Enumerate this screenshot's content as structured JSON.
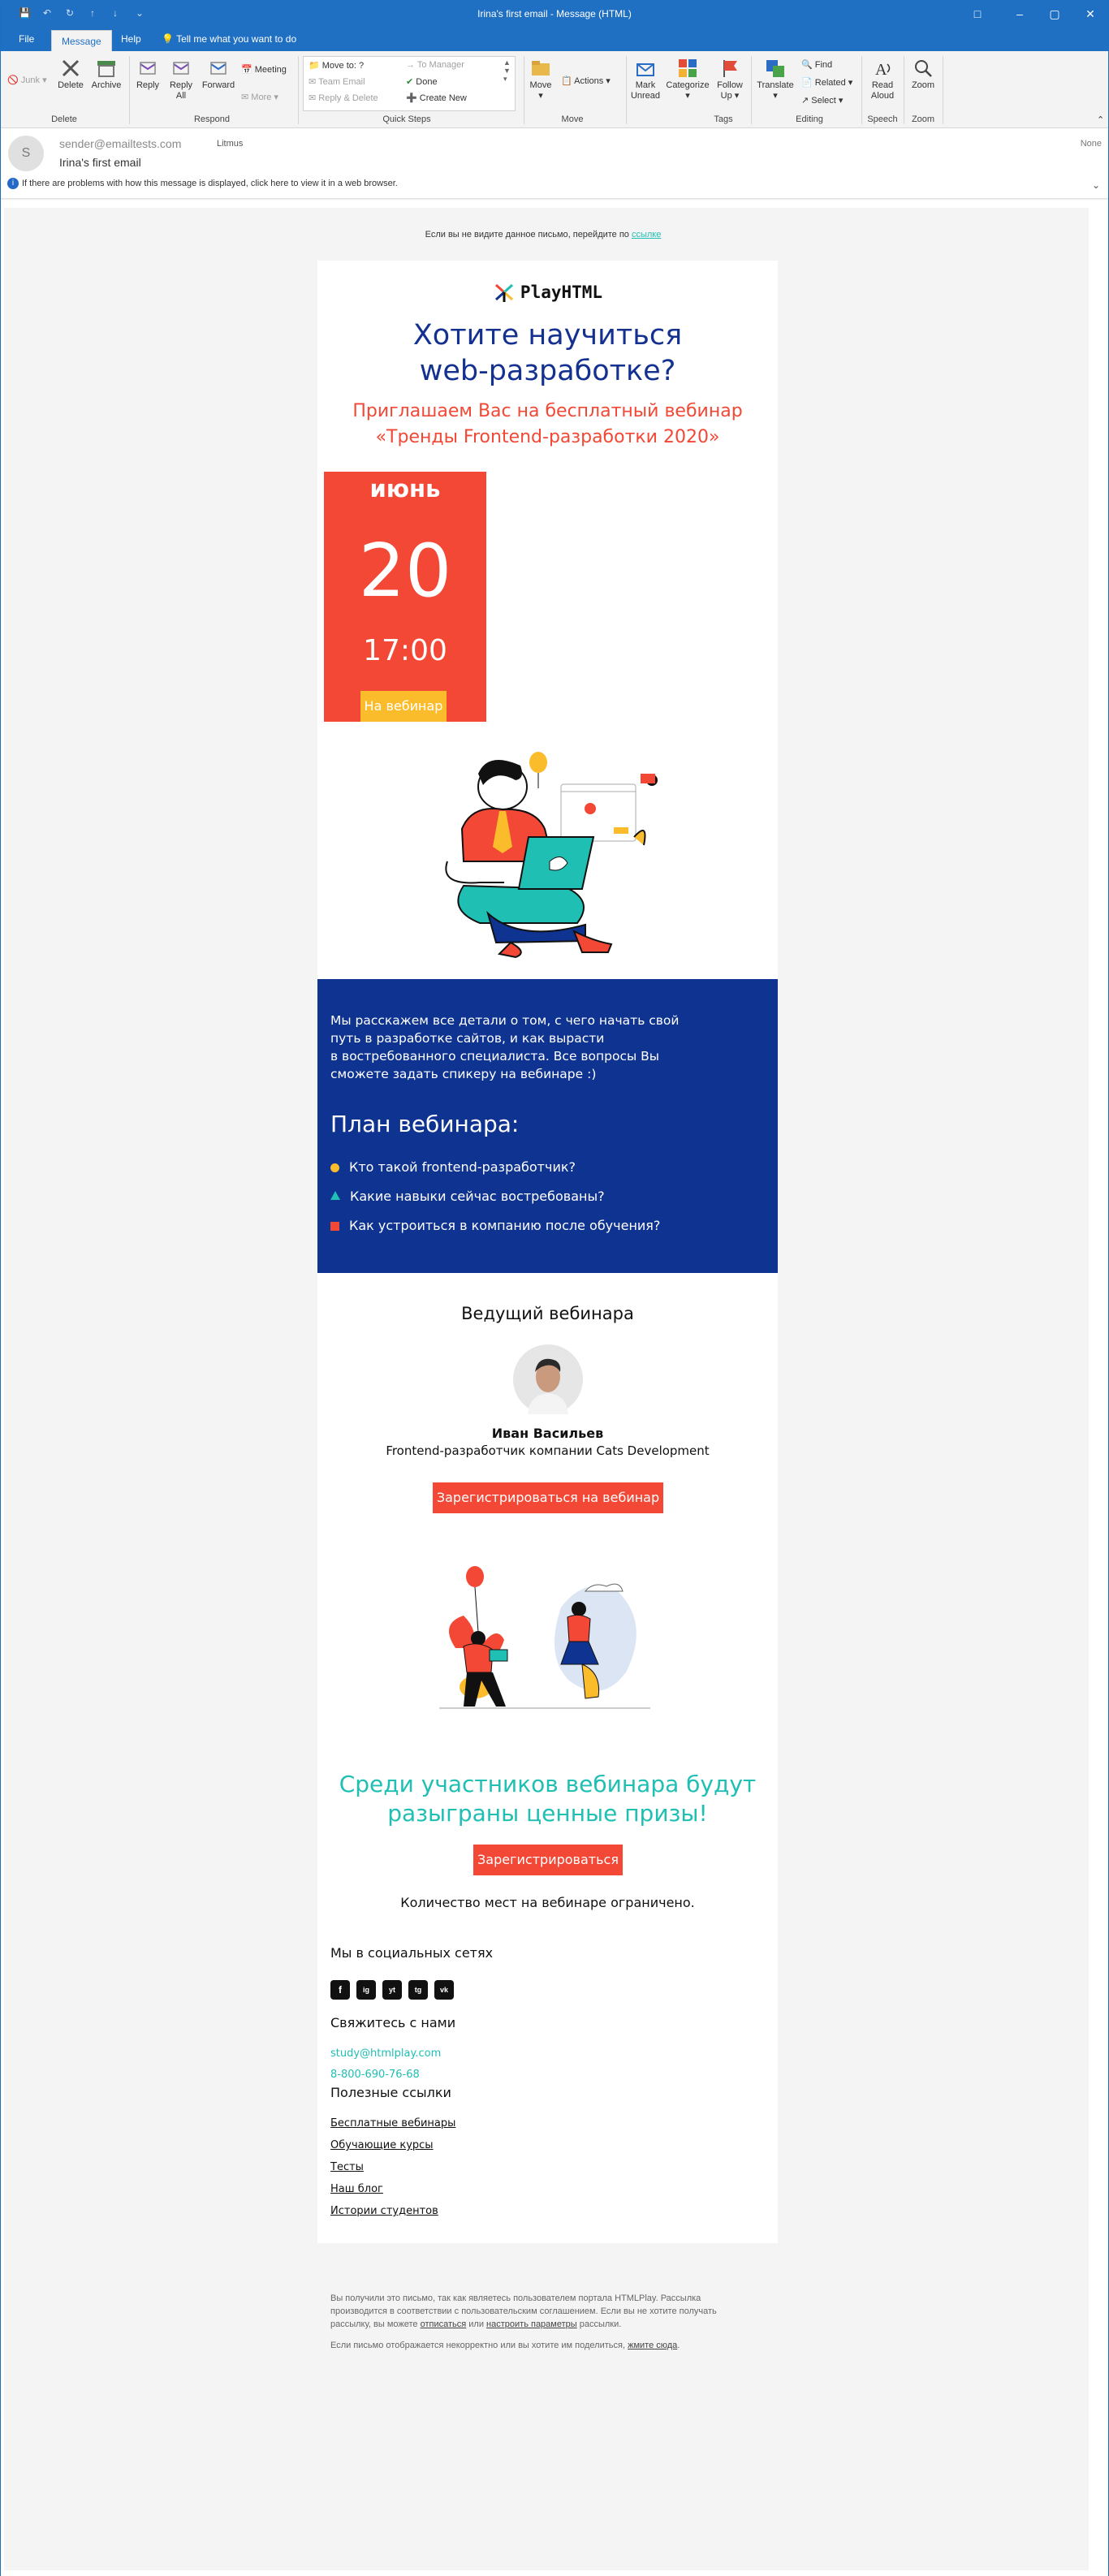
{
  "window": {
    "title": "Irina's first email  -  Message (HTML)"
  },
  "tabs": [
    "File",
    "Message",
    "Help"
  ],
  "tell_me": "Tell me what you want to do",
  "ribbon": {
    "junk": "Junk",
    "delete": "Delete",
    "archive": "Archive",
    "reply": "Reply",
    "reply_all": "Reply All",
    "forward": "Forward",
    "meeting": "Meeting",
    "more": "More",
    "quick_steps": [
      "Move to: ?",
      "Team Email",
      "Reply & Delete",
      "To Manager",
      "Done",
      "Create New"
    ],
    "move": "Move",
    "actions": "Actions",
    "mark_unread": "Mark Unread",
    "categorize": "Categorize",
    "follow_up": "Follow Up",
    "translate": "Translate",
    "find": "Find",
    "related": "Related",
    "select": "Select",
    "read_aloud": "Read Aloud",
    "zoom": "Zoom",
    "groups": [
      "Delete",
      "Respond",
      "Quick Steps",
      "Move",
      "Tags",
      "Editing",
      "Speech",
      "Zoom"
    ]
  },
  "header": {
    "avatar": "S",
    "from": "sender@emailtests.com",
    "to": "Litmus",
    "subject": "Irina's first email",
    "flag": "None",
    "info": "If there are problems with how this message is displayed, click here to view it in a web browser."
  },
  "email": {
    "preheader": "Если вы не видите данное письмо, перейдите по",
    "preheader_link": "ссылке",
    "logo": "PlayHTML",
    "headline_1": "Хотите научиться",
    "headline_2": "web-разработке?",
    "invite_1": "Приглашаем Вас на бесплатный вебинар",
    "invite_2": "«Тренды Frontend-разработки 2020»",
    "month": "июнь",
    "day": "20",
    "time": "17:00",
    "webinar_btn": "На вебинар",
    "intro_1": "Мы расскажем все детали о том, с чего начать свой",
    "intro_2": "путь в разработке сайтов, и как вырасти",
    "intro_3": "в востребованного специалиста. Все вопросы Вы",
    "intro_4": "сможете задать спикеру на вебинаре :)",
    "plan_title": "План вебинара:",
    "plan": [
      "Кто такой frontend-разработчик?",
      "Какие навыки сейчас востребованы?",
      "Как устроиться в компанию после обучения?"
    ],
    "host_title": "Ведущий вебинара",
    "host_name": "Иван Васильев",
    "host_role": "Frontend-разработчик компании Cats Development",
    "register_btn": "Зарегистрироваться на вебинар",
    "prize_1": "Среди участников вебинара будут",
    "prize_2": "разыграны ценные призы!",
    "register_btn2": "Зарегистрироваться",
    "limited": "Количество мест на вебинаре ограничено.",
    "social_title": "Мы в социальных сетях",
    "social": [
      "f",
      "ig",
      "yt",
      "tg",
      "vk"
    ],
    "contact_title": "Свяжитесь с нами",
    "contact_email": "study@htmlplay.com",
    "contact_phone": "8-800-690-76-68",
    "links_title": "Полезные ссылки",
    "links": [
      "Бесплатные вебинары",
      "Обучающие курсы",
      "Тесты",
      "Наш блог",
      "Истории студентов"
    ],
    "legal_1": "Вы получили это письмо, так как являетесь пользователем портала HTMLPlay. Рассылка",
    "legal_2": "производится в соответствии с пользовательским соглашением. Если вы не хотите получать",
    "legal_3a": "рассылку, вы можете",
    "legal_unsub": "отписаться",
    "legal_or": "или",
    "legal_settings": "настроить параметры",
    "legal_3b": "рассылки.",
    "legal_4": "Если письмо отображается некорректно или вы хотите им поделиться,",
    "legal_click": "жмите сюда",
    "colors": {
      "navy": "#0f3390",
      "red": "#f24835",
      "teal": "#1fbfb3",
      "yellow": "#fbbc2b"
    }
  }
}
